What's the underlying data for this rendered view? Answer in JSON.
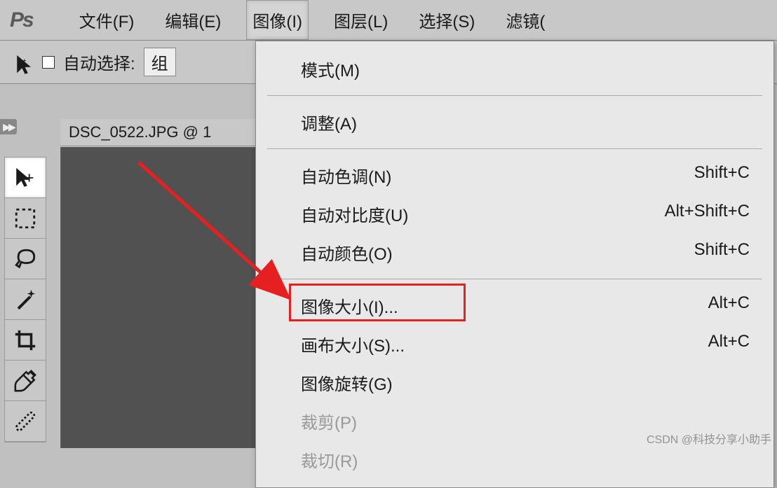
{
  "topbar": {
    "logo": "Ps",
    "menus": {
      "file": "文件(F)",
      "edit": "编辑(E)",
      "image": "图像(I)",
      "layer": "图层(L)",
      "select": "选择(S)",
      "filter": "滤镜("
    }
  },
  "options_bar": {
    "auto_select_label": "自动选择:",
    "group": "组"
  },
  "document": {
    "tab_title": "DSC_0522.JPG @ 1"
  },
  "menu": {
    "mode": "模式(M)",
    "adjustments": "调整(A)",
    "auto_tone": {
      "label": "自动色调(N)",
      "shortcut": "Shift+C"
    },
    "auto_contrast": {
      "label": "自动对比度(U)",
      "shortcut": "Alt+Shift+C"
    },
    "auto_color": {
      "label": "自动颜色(O)",
      "shortcut": "Shift+C"
    },
    "image_size": {
      "label": "图像大小(I)...",
      "shortcut": "Alt+C"
    },
    "canvas_size": {
      "label": "画布大小(S)...",
      "shortcut": "Alt+C"
    },
    "image_rotation": "图像旋转(G)",
    "crop": "裁剪(P)",
    "trim": "裁切(R)"
  },
  "watermark": "CSDN @科技分享小助手"
}
